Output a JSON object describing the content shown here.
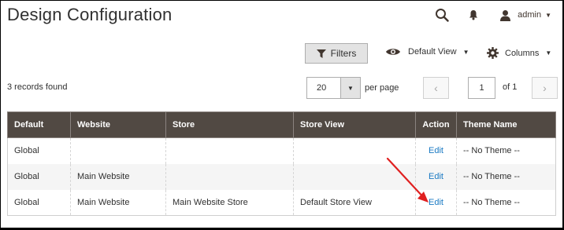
{
  "page": {
    "title": "Design Configuration"
  },
  "header": {
    "user_name": "admin",
    "icons": [
      "search-icon",
      "bell-icon",
      "user-icon",
      "chevron-down-icon"
    ]
  },
  "toolbar": {
    "filters_label": "Filters",
    "view_label": "Default View",
    "columns_label": "Columns"
  },
  "records_found": "3 records found",
  "pagination": {
    "per_page_value": "20",
    "per_page_label": "per page",
    "current_page": "1",
    "of_label": "of 1"
  },
  "grid": {
    "columns": [
      "Default",
      "Website",
      "Store",
      "Store View",
      "Action",
      "Theme Name"
    ],
    "rows": [
      {
        "default": "Global",
        "website": "",
        "store": "",
        "store_view": "",
        "action": "Edit",
        "theme": "-- No Theme --"
      },
      {
        "default": "Global",
        "website": "Main Website",
        "store": "",
        "store_view": "",
        "action": "Edit",
        "theme": "-- No Theme --"
      },
      {
        "default": "Global",
        "website": "Main Website",
        "store": "Main Website Store",
        "store_view": "Default Store View",
        "action": "Edit",
        "theme": "-- No Theme --"
      }
    ]
  },
  "colors": {
    "header_bg": "#514943",
    "link": "#1979c3",
    "annotation_arrow": "#e02020"
  }
}
